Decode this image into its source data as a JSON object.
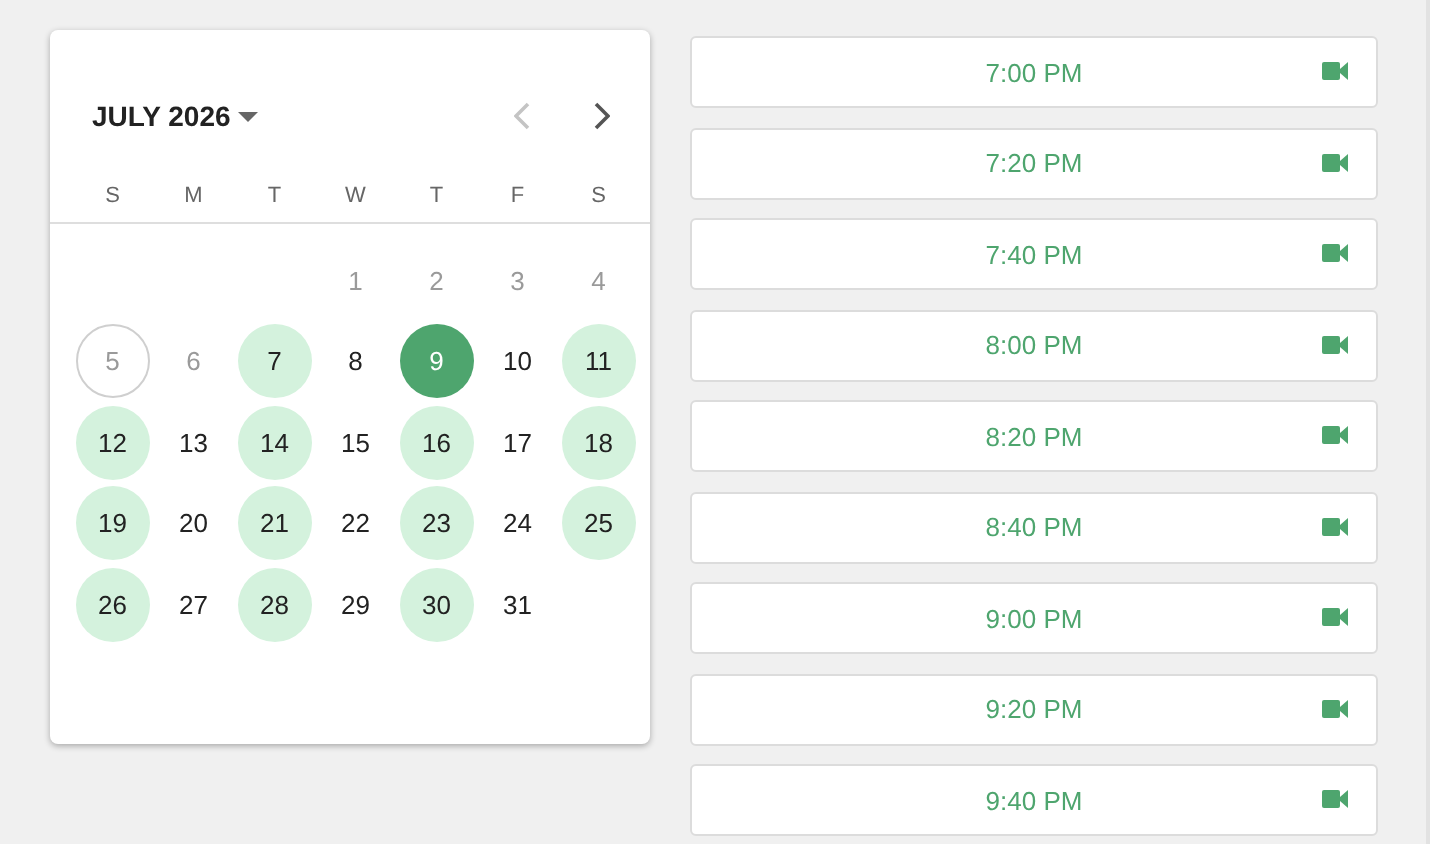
{
  "calendar": {
    "month_label": "JULY 2026",
    "prev_disabled": true,
    "next_disabled": false,
    "weekdays": [
      "S",
      "M",
      "T",
      "W",
      "T",
      "F",
      "S"
    ],
    "weeks": [
      [
        {
          "kind": "empty"
        },
        {
          "kind": "empty"
        },
        {
          "kind": "empty"
        },
        {
          "day": "1",
          "kind": "past"
        },
        {
          "day": "2",
          "kind": "past"
        },
        {
          "day": "3",
          "kind": "past"
        },
        {
          "day": "4",
          "kind": "past"
        }
      ],
      [
        {
          "day": "5",
          "kind": "today"
        },
        {
          "day": "6",
          "kind": "past"
        },
        {
          "day": "7",
          "kind": "available"
        },
        {
          "day": "8",
          "kind": "normal"
        },
        {
          "day": "9",
          "kind": "selected"
        },
        {
          "day": "10",
          "kind": "normal"
        },
        {
          "day": "11",
          "kind": "available"
        }
      ],
      [
        {
          "day": "12",
          "kind": "available"
        },
        {
          "day": "13",
          "kind": "normal"
        },
        {
          "day": "14",
          "kind": "available"
        },
        {
          "day": "15",
          "kind": "normal"
        },
        {
          "day": "16",
          "kind": "available"
        },
        {
          "day": "17",
          "kind": "normal"
        },
        {
          "day": "18",
          "kind": "available"
        }
      ],
      [
        {
          "day": "19",
          "kind": "available"
        },
        {
          "day": "20",
          "kind": "normal"
        },
        {
          "day": "21",
          "kind": "available"
        },
        {
          "day": "22",
          "kind": "normal"
        },
        {
          "day": "23",
          "kind": "available"
        },
        {
          "day": "24",
          "kind": "normal"
        },
        {
          "day": "25",
          "kind": "available"
        }
      ],
      [
        {
          "day": "26",
          "kind": "available"
        },
        {
          "day": "27",
          "kind": "normal"
        },
        {
          "day": "28",
          "kind": "available"
        },
        {
          "day": "29",
          "kind": "normal"
        },
        {
          "day": "30",
          "kind": "available"
        },
        {
          "day": "31",
          "kind": "normal"
        },
        {
          "kind": "empty"
        }
      ]
    ]
  },
  "time_slots": [
    {
      "time": "7:00 PM"
    },
    {
      "time": "7:20 PM"
    },
    {
      "time": "7:40 PM"
    },
    {
      "time": "8:00 PM"
    },
    {
      "time": "8:20 PM"
    },
    {
      "time": "8:40 PM"
    },
    {
      "time": "9:00 PM"
    },
    {
      "time": "9:20 PM"
    },
    {
      "time": "9:40 PM"
    }
  ]
}
